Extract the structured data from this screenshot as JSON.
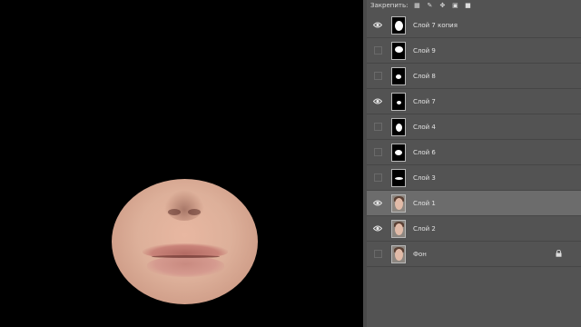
{
  "lock_bar": {
    "label": "Закрепить:",
    "icons": [
      "transparency-lock-icon",
      "brush-icon",
      "move-icon",
      "artboard-icon",
      "lock-icon"
    ]
  },
  "layers": [
    {
      "name": "Слой 7 копия",
      "visible": true,
      "thumb": "mask-oval-large",
      "selected": false
    },
    {
      "name": "Слой 9",
      "visible": false,
      "thumb": "mask-mushroom",
      "selected": false
    },
    {
      "name": "Слой 8",
      "visible": false,
      "thumb": "mask-blob-small",
      "selected": false
    },
    {
      "name": "Слой 7",
      "visible": true,
      "thumb": "mask-dot",
      "selected": false
    },
    {
      "name": "Слой 4",
      "visible": false,
      "thumb": "mask-oval",
      "selected": false
    },
    {
      "name": "Слой 6",
      "visible": false,
      "thumb": "mask-ellipse",
      "selected": false
    },
    {
      "name": "Слой 3",
      "visible": false,
      "thumb": "mask-bar",
      "selected": false
    },
    {
      "name": "Слой 1",
      "visible": true,
      "thumb": "photo-face",
      "selected": true
    },
    {
      "name": "Слой 2",
      "visible": true,
      "thumb": "photo-face",
      "selected": false
    },
    {
      "name": "Фон",
      "visible": false,
      "thumb": "photo-face",
      "selected": false,
      "locked": true
    }
  ],
  "colors": {
    "panel": "#535353",
    "selected_row": "#6c6c6c",
    "canvas": "#000000"
  }
}
